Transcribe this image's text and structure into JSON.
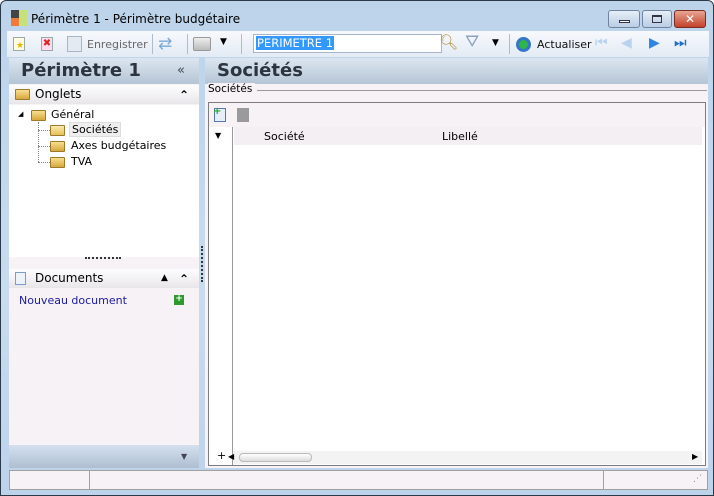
{
  "window": {
    "title": "Périmètre 1 -  Périmètre budgétaire",
    "minimize": "minimize",
    "maximize": "maximize",
    "close": "✕"
  },
  "toolbar": {
    "save_label": "Enregistrer",
    "search_value": "PERIMETRE 1",
    "refresh_label": "Actualiser"
  },
  "left_panel": {
    "title": "Périmètre 1",
    "collapse": "«",
    "tabs_section": {
      "label": "Onglets",
      "toggle": "⌃"
    },
    "tree": {
      "root": "Général",
      "children": [
        "Sociétés",
        "Axes budgétaires",
        "TVA"
      ],
      "selected": "Sociétés"
    },
    "documents_section": {
      "label": "Documents",
      "new_document": "Nouveau document"
    }
  },
  "main": {
    "title": "Sociétés",
    "group_label": "Sociétés",
    "grid": {
      "columns": [
        "Société",
        "Libellé"
      ],
      "rows": []
    },
    "scroll_add": "+"
  },
  "colors": {
    "accent": "#3399ff",
    "link": "#1a1aa6",
    "header_grad": "#b5c5d6"
  }
}
